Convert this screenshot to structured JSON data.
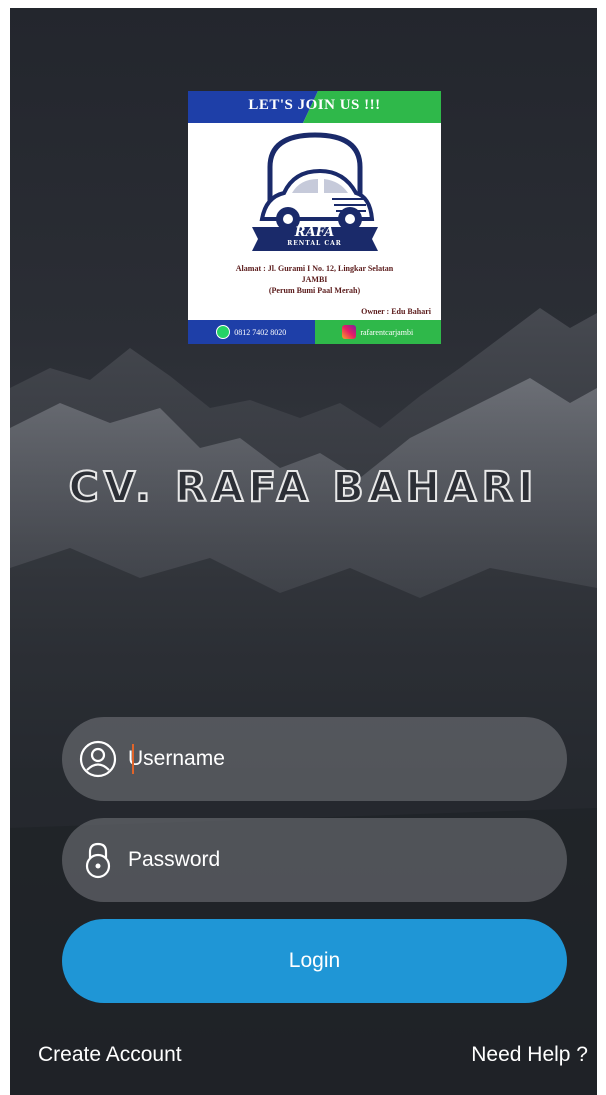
{
  "logo": {
    "banner_text": "LET'S JOIN US !!!",
    "brand_name": "RAFA",
    "brand_tagline": "RENTAL CAR",
    "address_line1": "Alamat :  Jl. Gurami I No. 12, Lingkar Selatan",
    "address_line2": "JAMBI",
    "address_line3": "(Perum Bumi Paal Merah)",
    "owner": "Owner : Edu Bahari",
    "phone": "0812 7402 8020",
    "instagram": "rafarentcarjambi",
    "colors": {
      "banner_blue": "#1e3fa8",
      "banner_green": "#2fb84a"
    }
  },
  "app": {
    "title": "CV. RAFA BAHARI"
  },
  "form": {
    "username": {
      "placeholder": "Username",
      "value": "",
      "icon": "user-icon"
    },
    "password": {
      "placeholder": "Password",
      "value": "",
      "icon": "lock-icon"
    },
    "login_label": "Login"
  },
  "links": {
    "create_account": "Create Account",
    "need_help": "Need Help ?"
  },
  "colors": {
    "accent": "#1f96d6",
    "caret": "#e0642a",
    "background": "#2b2e35"
  }
}
